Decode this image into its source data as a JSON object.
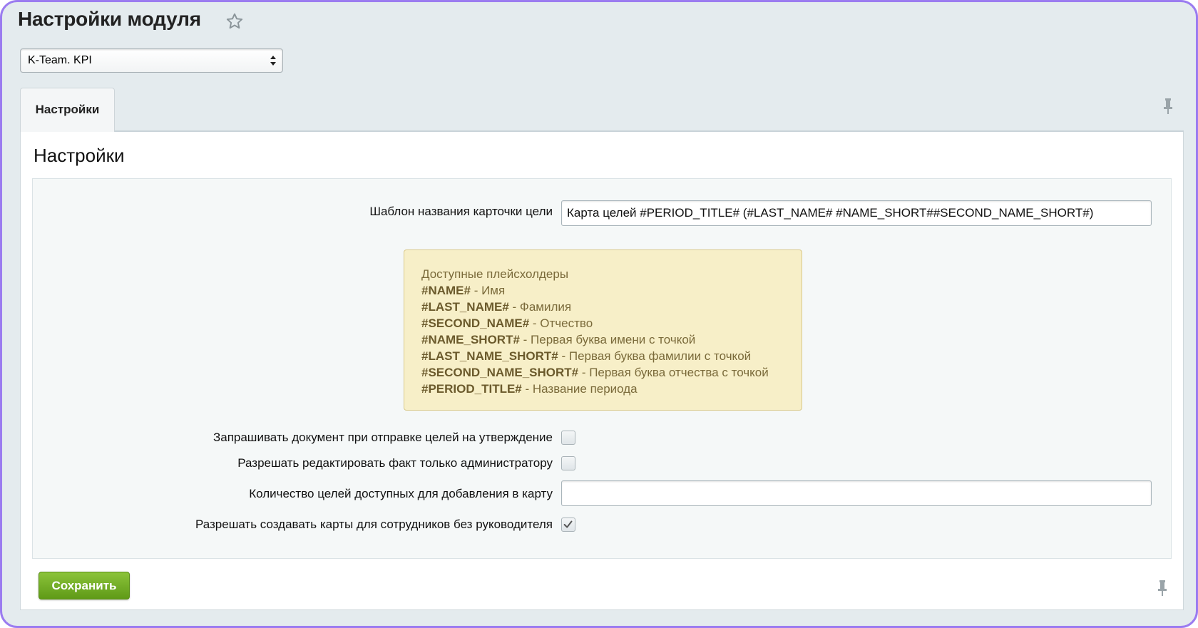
{
  "header": {
    "page_title": "Настройки модуля"
  },
  "module_select": {
    "selected": "K-Team. KPI"
  },
  "tabs": [
    {
      "label": "Настройки",
      "active": true
    }
  ],
  "section": {
    "title": "Настройки"
  },
  "form": {
    "card_title_template": {
      "label": "Шаблон названия карточки цели",
      "value": "Карта целей #PERIOD_TITLE# (#LAST_NAME# #NAME_SHORT##SECOND_NAME_SHORT#)"
    },
    "placeholders_hint": {
      "heading": "Доступные плейсхолдеры",
      "items": [
        {
          "code": "#NAME#",
          "desc": " - Имя"
        },
        {
          "code": "#LAST_NAME#",
          "desc": " - Фамилия"
        },
        {
          "code": "#SECOND_NAME#",
          "desc": " - Отчество"
        },
        {
          "code": "#NAME_SHORT#",
          "desc": " - Первая буква имени с точкой"
        },
        {
          "code": "#LAST_NAME_SHORT#",
          "desc": " - Первая буква фамилии с точкой"
        },
        {
          "code": "#SECOND_NAME_SHORT#",
          "desc": " - Первая буква отчества с точкой"
        },
        {
          "code": "#PERIOD_TITLE#",
          "desc": " - Название периода"
        }
      ]
    },
    "request_document": {
      "label": "Запрашивать документ при отправке целей на утверждение",
      "checked": false
    },
    "admin_only_edit_fact": {
      "label": "Разрешать редактировать факт только администратору",
      "checked": false
    },
    "goals_count": {
      "label": "Количество целей доступных для добавления в карту",
      "value": ""
    },
    "allow_no_manager": {
      "label": "Разрешать создавать карты для сотрудников без руководителя",
      "checked": true
    }
  },
  "footer": {
    "save_label": "Сохранить"
  },
  "colors": {
    "accent_green": "#6aa81f",
    "hint_background": "#f7efc8",
    "frame_border": "#9b7cf0"
  }
}
